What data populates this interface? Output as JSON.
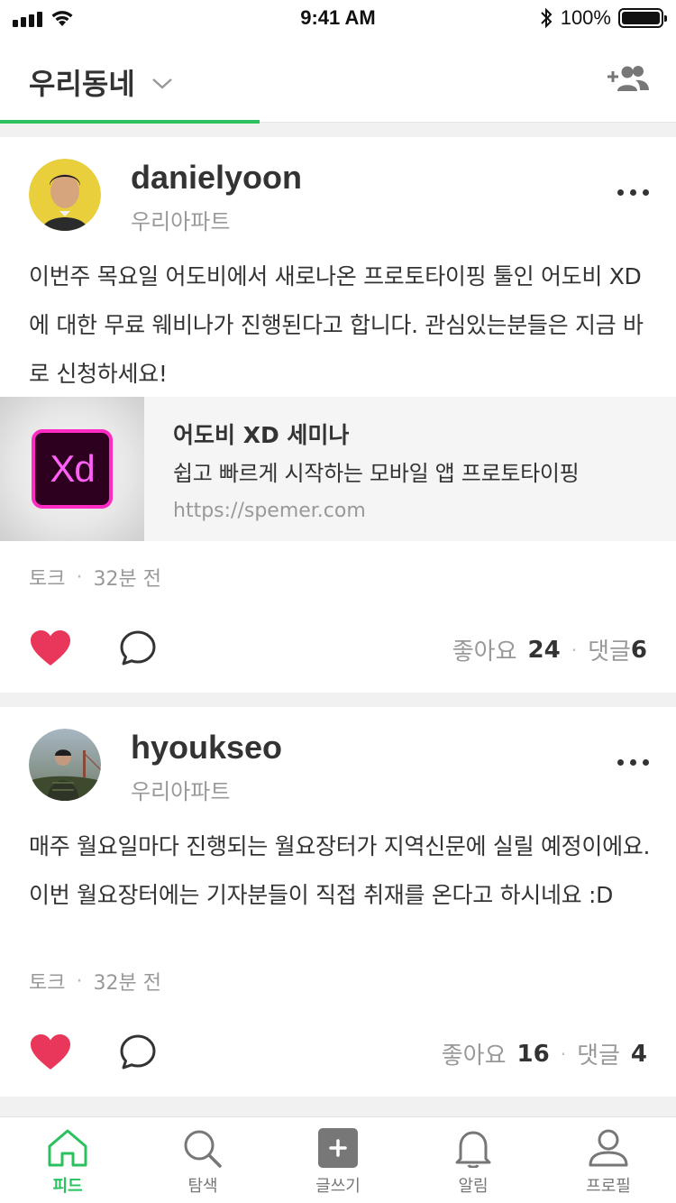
{
  "status_bar": {
    "time": "9:41 AM",
    "battery_text": "100%"
  },
  "nav": {
    "title": "우리동네"
  },
  "posts": [
    {
      "username": "danielyoon",
      "location": "우리아파트",
      "text": "이번주 목요일 어도비에서 새로나온 프로토타이핑 툴인 어도비 XD에 대한 무료 웨비나가 진행된다고 합니다. 관심있는분들은 지금 바로 신청하세요!",
      "link": {
        "logo_text": "Xd",
        "title": "어도비 XD 세미나",
        "description": "쉽고 빠르게 시작하는 모바일 앱 프로토타이핑",
        "url": "https://spemer.com"
      },
      "category": "토크",
      "time": "32분 전",
      "likes_label": "좋아요",
      "likes_count": "24",
      "comments_label": "댓글",
      "comments_count": "6"
    },
    {
      "username": "hyoukseo",
      "location": "우리아파트",
      "text": "매주 월요일마다 진행되는 월요장터가 지역신문에 실릴 예정이에요. 이번 월요장터에는 기자분들이 직접 취재를 온다고 하시네요 :D",
      "category": "토크",
      "time": "32분 전",
      "likes_label": "좋아요",
      "likes_count": "16",
      "comments_label": "댓글",
      "comments_count": "4"
    }
  ],
  "tabbar": {
    "items": [
      {
        "label": "피드",
        "icon": "home-icon",
        "active": true
      },
      {
        "label": "탐색",
        "icon": "search-icon",
        "active": false
      },
      {
        "label": "글쓰기",
        "icon": "plus-square-icon",
        "active": false
      },
      {
        "label": "알림",
        "icon": "bell-icon",
        "active": false
      },
      {
        "label": "프로필",
        "icon": "user-icon",
        "active": false
      }
    ]
  },
  "colors": {
    "accent": "#2ac25e",
    "like": "#e8375a",
    "text": "#333333",
    "muted": "#999999"
  }
}
